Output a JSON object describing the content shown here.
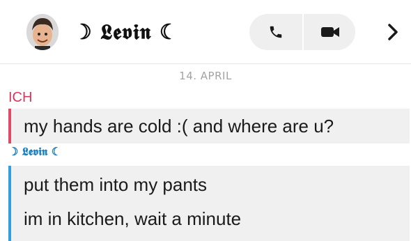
{
  "header": {
    "contact_name": "☽ 𝕷𝖊𝖛𝖎𝖓 ☾",
    "avatar_icon": "bitmoji-avatar",
    "voice_call_icon": "phone-icon",
    "video_call_icon": "video-camera-icon",
    "next_icon": "chevron-right-icon"
  },
  "chat": {
    "date": "14. APRIL",
    "messages": [
      {
        "sender": "ICH",
        "lines": [
          "my hands are cold :( and where are u?"
        ],
        "color": "#e04a69"
      },
      {
        "sender": "☽ 𝕷𝖊𝖛𝖎𝖓 ☾",
        "lines": [
          "put them into my pants",
          "im in kitchen, wait a minute"
        ],
        "color": "#2f9fe0"
      }
    ]
  }
}
